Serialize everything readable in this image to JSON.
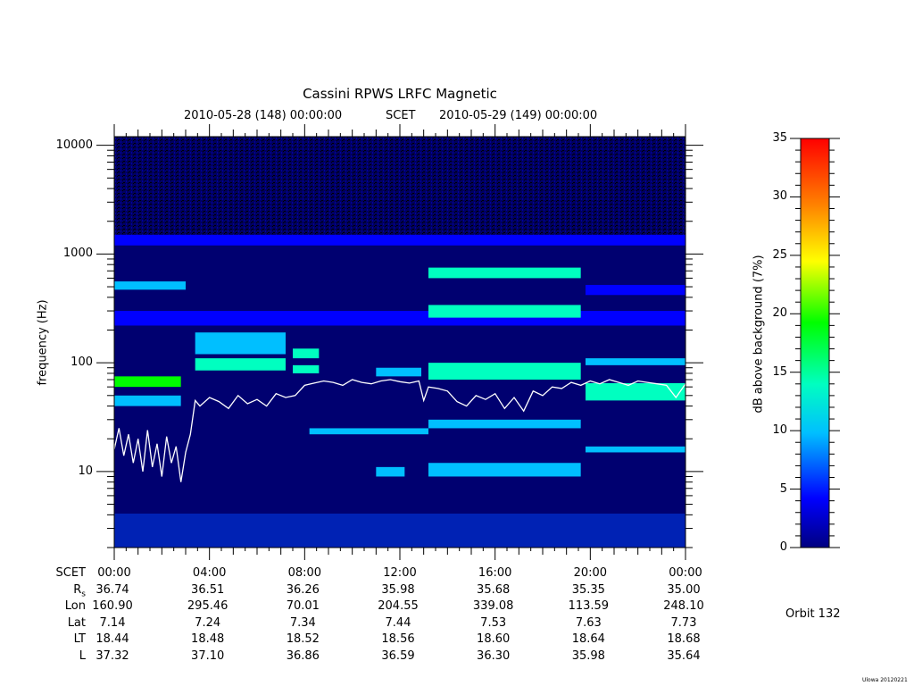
{
  "chart_data": {
    "type": "heatmap",
    "title": "Cassini RPWS LRFC Magnetic",
    "subtitle_left": "2010-05-28 (148) 00:00:00",
    "subtitle_mid": "SCET",
    "subtitle_right": "2010-05-29 (149) 00:00:00",
    "ylabel": "frequency (Hz)",
    "yscale": "log",
    "ylim": [
      2,
      12000
    ],
    "yticks": [
      10,
      100,
      1000,
      10000
    ],
    "ytick_labels": [
      "10",
      "100",
      "1000",
      "10000"
    ],
    "xlim_hours": [
      0,
      24
    ],
    "xticks_hours": [
      0,
      4,
      8,
      12,
      16,
      20,
      24
    ],
    "xtick_labels": [
      "00:00",
      "04:00",
      "08:00",
      "12:00",
      "16:00",
      "20:00",
      "00:00"
    ],
    "colorbar": {
      "label": "dB above background (7%)",
      "range": [
        0,
        35
      ],
      "ticks": [
        0,
        5,
        10,
        15,
        20,
        25,
        30,
        35
      ],
      "tick_labels": [
        "0",
        "5",
        "10",
        "15",
        "20",
        "25",
        "30",
        "35"
      ],
      "colors": [
        "#000080",
        "#0000ff",
        "#00bfff",
        "#00ffc0",
        "#00ff00",
        "#ffff00",
        "#ff8000",
        "#ff0000"
      ]
    },
    "bands": [
      {
        "t0": 0,
        "t1": 24,
        "f0": 1200,
        "f1": 1500,
        "level": 6
      },
      {
        "t0": 0,
        "t1": 3.0,
        "f0": 470,
        "f1": 560,
        "level": 10
      },
      {
        "t0": 0,
        "t1": 2.8,
        "f0": 60,
        "f1": 75,
        "level": 20
      },
      {
        "t0": 0,
        "t1": 2.8,
        "f0": 40,
        "f1": 50,
        "level": 10
      },
      {
        "t0": 0,
        "t1": 24,
        "f0": 220,
        "f1": 300,
        "level": 6
      },
      {
        "t0": 3.4,
        "t1": 7.2,
        "f0": 120,
        "f1": 190,
        "level": 12
      },
      {
        "t0": 3.4,
        "t1": 7.2,
        "f0": 85,
        "f1": 110,
        "level": 14
      },
      {
        "t0": 7.5,
        "t1": 8.6,
        "f0": 110,
        "f1": 135,
        "level": 16
      },
      {
        "t0": 7.5,
        "t1": 8.6,
        "f0": 80,
        "f1": 95,
        "level": 16
      },
      {
        "t0": 8.2,
        "t1": 13.2,
        "f0": 22,
        "f1": 25,
        "level": 10
      },
      {
        "t0": 11.0,
        "t1": 12.9,
        "f0": 75,
        "f1": 90,
        "level": 12
      },
      {
        "t0": 11.0,
        "t1": 12.2,
        "f0": 9,
        "f1": 11,
        "level": 12
      },
      {
        "t0": 13.2,
        "t1": 19.6,
        "f0": 600,
        "f1": 750,
        "level": 16
      },
      {
        "t0": 13.2,
        "t1": 19.6,
        "f0": 260,
        "f1": 340,
        "level": 14
      },
      {
        "t0": 13.2,
        "t1": 19.6,
        "f0": 70,
        "f1": 100,
        "level": 16
      },
      {
        "t0": 13.2,
        "t1": 19.6,
        "f0": 25,
        "f1": 30,
        "level": 12
      },
      {
        "t0": 13.2,
        "t1": 19.6,
        "f0": 9,
        "f1": 12,
        "level": 10
      },
      {
        "t0": 19.8,
        "t1": 24,
        "f0": 420,
        "f1": 520,
        "level": 8
      },
      {
        "t0": 19.8,
        "t1": 24,
        "f0": 95,
        "f1": 110,
        "level": 10
      },
      {
        "t0": 19.8,
        "t1": 24,
        "f0": 45,
        "f1": 65,
        "level": 14
      },
      {
        "t0": 19.8,
        "t1": 24,
        "f0": 15,
        "f1": 17,
        "level": 9
      }
    ],
    "series": [
      {
        "x_hours": [
          0,
          0.2,
          0.4,
          0.6,
          0.8,
          1.0,
          1.2,
          1.4,
          1.6,
          1.8,
          2.0,
          2.2,
          2.4,
          2.6,
          2.8,
          3.0,
          3.2,
          3.4,
          3.6,
          4.0,
          4.4,
          4.8,
          5.2,
          5.6,
          6.0,
          6.4,
          6.8,
          7.2,
          7.6,
          8.0,
          8.4,
          8.8,
          9.2,
          9.6,
          10.0,
          10.4,
          10.8,
          11.2,
          11.6,
          12.0,
          12.4,
          12.8,
          13.0,
          13.2,
          13.6,
          14.0,
          14.4,
          14.8,
          15.2,
          15.6,
          16.0,
          16.4,
          16.8,
          17.2,
          17.6,
          18.0,
          18.4,
          18.8,
          19.2,
          19.6,
          20.0,
          20.4,
          20.8,
          21.2,
          21.6,
          22.0,
          22.4,
          22.8,
          23.2,
          23.6,
          24.0
        ],
        "y_hz": [
          16,
          25,
          14,
          22,
          12,
          20,
          10,
          24,
          11,
          18,
          9,
          21,
          12,
          17,
          8,
          15,
          22,
          45,
          40,
          48,
          44,
          38,
          50,
          42,
          46,
          40,
          52,
          48,
          50,
          62,
          65,
          68,
          66,
          62,
          70,
          66,
          64,
          68,
          70,
          67,
          65,
          68,
          45,
          60,
          58,
          55,
          44,
          40,
          50,
          46,
          52,
          38,
          48,
          36,
          55,
          50,
          60,
          58,
          66,
          62,
          68,
          64,
          70,
          66,
          62,
          68,
          66,
          64,
          62,
          48,
          64
        ]
      }
    ]
  },
  "ephemeris": {
    "rows": [
      {
        "key": "SCET",
        "values": [
          "00:00",
          "04:00",
          "08:00",
          "12:00",
          "16:00",
          "20:00",
          "00:00"
        ]
      },
      {
        "key": "R",
        "sub": "s",
        "values": [
          "36.74",
          "36.51",
          "36.26",
          "35.98",
          "35.68",
          "35.35",
          "35.00"
        ]
      },
      {
        "key": "Lon",
        "values": [
          "160.90",
          "295.46",
          "70.01",
          "204.55",
          "339.08",
          "113.59",
          "248.10"
        ]
      },
      {
        "key": "Lat",
        "values": [
          "7.14",
          "7.24",
          "7.34",
          "7.44",
          "7.53",
          "7.63",
          "7.73"
        ]
      },
      {
        "key": "LT",
        "values": [
          "18.44",
          "18.48",
          "18.52",
          "18.56",
          "18.60",
          "18.64",
          "18.68"
        ]
      },
      {
        "key": "L",
        "values": [
          "37.32",
          "37.10",
          "36.86",
          "36.59",
          "36.30",
          "35.98",
          "35.64"
        ]
      }
    ]
  },
  "orbit_label": "Orbit 132",
  "credit": "Ulowa 20120221"
}
